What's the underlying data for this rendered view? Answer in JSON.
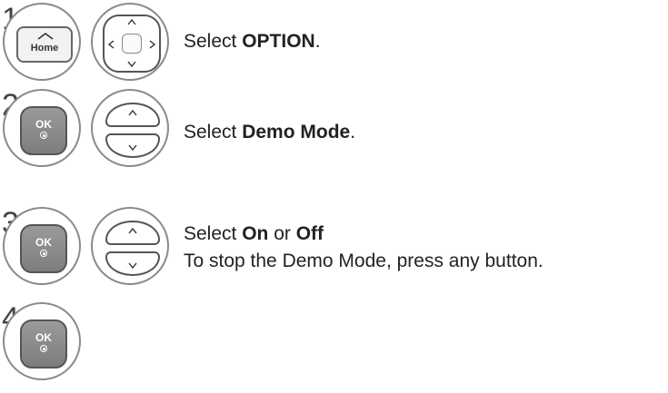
{
  "steps": [
    {
      "number": "1",
      "key_label": "Home",
      "text_prefix": "Select ",
      "text_bold": "OPTION",
      "text_suffix": "."
    },
    {
      "number": "2",
      "key_label": "OK",
      "text_prefix": "Select ",
      "text_bold": "Demo Mode",
      "text_suffix": "."
    },
    {
      "number": "3",
      "key_label": "OK",
      "text_prefix": "Select ",
      "text_bold": "On",
      "text_middle": " or ",
      "text_bold_2": "Off",
      "note": "To stop the Demo Mode, press any button."
    },
    {
      "number": "4",
      "key_label": "OK"
    }
  ],
  "icons": {
    "up": "up-chevron",
    "down": "down-chevron",
    "left": "left-chevron",
    "right": "right-chevron"
  }
}
